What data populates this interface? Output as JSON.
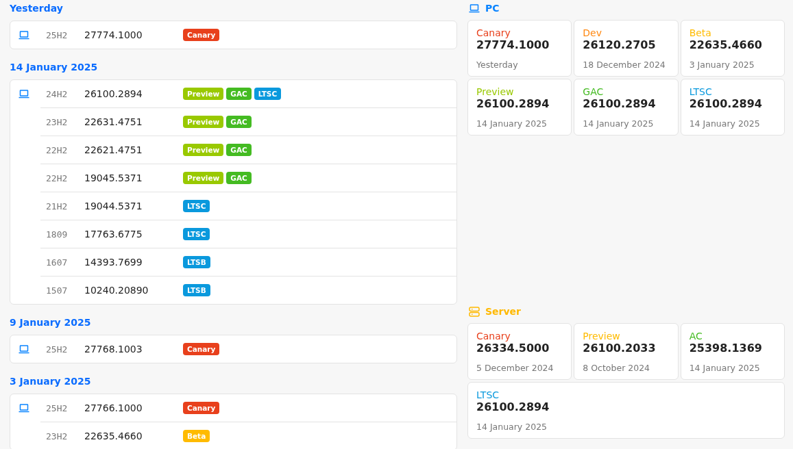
{
  "release_groups": [
    {
      "date": "Yesterday",
      "builds": [
        {
          "version": "25H2",
          "build": "27774.1000",
          "tags": [
            {
              "label": "Canary",
              "color": "#e8401c"
            }
          ]
        }
      ]
    },
    {
      "date": "14 January 2025",
      "builds": [
        {
          "version": "24H2",
          "build": "26100.2894",
          "tags": [
            {
              "label": "Preview",
              "color": "#99c900"
            },
            {
              "label": "GAC",
              "color": "#44bb22"
            },
            {
              "label": "LTSC",
              "color": "#0a99dd"
            }
          ]
        },
        {
          "version": "23H2",
          "build": "22631.4751",
          "tags": [
            {
              "label": "Preview",
              "color": "#99c900"
            },
            {
              "label": "GAC",
              "color": "#44bb22"
            }
          ]
        },
        {
          "version": "22H2",
          "build": "22621.4751",
          "tags": [
            {
              "label": "Preview",
              "color": "#99c900"
            },
            {
              "label": "GAC",
              "color": "#44bb22"
            }
          ]
        },
        {
          "version": "22H2",
          "build": "19045.5371",
          "tags": [
            {
              "label": "Preview",
              "color": "#99c900"
            },
            {
              "label": "GAC",
              "color": "#44bb22"
            }
          ]
        },
        {
          "version": "21H2",
          "build": "19044.5371",
          "tags": [
            {
              "label": "LTSC",
              "color": "#0a99dd"
            }
          ]
        },
        {
          "version": "1809",
          "build": "17763.6775",
          "tags": [
            {
              "label": "LTSC",
              "color": "#0a99dd"
            }
          ]
        },
        {
          "version": "1607",
          "build": "14393.7699",
          "tags": [
            {
              "label": "LTSB",
              "color": "#0a99dd"
            }
          ]
        },
        {
          "version": "1507",
          "build": "10240.20890",
          "tags": [
            {
              "label": "LTSB",
              "color": "#0a99dd"
            }
          ]
        }
      ]
    },
    {
      "date": "9 January 2025",
      "builds": [
        {
          "version": "25H2",
          "build": "27768.1003",
          "tags": [
            {
              "label": "Canary",
              "color": "#e8401c"
            }
          ]
        }
      ]
    },
    {
      "date": "3 January 2025",
      "builds": [
        {
          "version": "25H2",
          "build": "27766.1000",
          "tags": [
            {
              "label": "Canary",
              "color": "#e8401c"
            }
          ]
        },
        {
          "version": "23H2",
          "build": "22635.4660",
          "tags": [
            {
              "label": "Beta",
              "color": "#ffbb00"
            }
          ]
        }
      ]
    }
  ],
  "platforms": [
    {
      "kind": "pc",
      "title": "PC",
      "color": "#0a84ff",
      "channels": [
        {
          "name": "Canary",
          "color": "#e8401c",
          "build": "27774.1000",
          "date": "Yesterday"
        },
        {
          "name": "Dev",
          "color": "#ff8811",
          "build": "26120.2705",
          "date": "18 December 2024"
        },
        {
          "name": "Beta",
          "color": "#ffbb00",
          "build": "22635.4660",
          "date": "3 January 2025"
        },
        {
          "name": "Preview",
          "color": "#99c900",
          "build": "26100.2894",
          "date": "14 January 2025"
        },
        {
          "name": "GAC",
          "color": "#44bb22",
          "build": "26100.2894",
          "date": "14 January 2025"
        },
        {
          "name": "LTSC",
          "color": "#0a99dd",
          "build": "26100.2894",
          "date": "14 January 2025"
        }
      ]
    },
    {
      "kind": "server",
      "title": "Server",
      "color": "#ffb900",
      "channels": [
        {
          "name": "Canary",
          "color": "#e8401c",
          "build": "26334.5000",
          "date": "5 December 2024"
        },
        {
          "name": "Preview",
          "color": "#ffbb00",
          "build": "26100.2033",
          "date": "8 October 2024"
        },
        {
          "name": "AC",
          "color": "#44bb22",
          "build": "25398.1369",
          "date": "14 January 2025"
        },
        {
          "name": "LTSC",
          "color": "#0a99dd",
          "build": "26100.2894",
          "date": "14 January 2025"
        }
      ]
    }
  ]
}
